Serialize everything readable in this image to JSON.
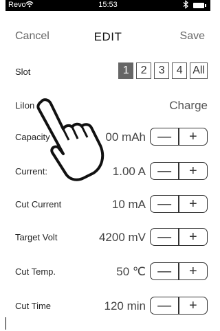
{
  "status_bar": {
    "carrier": "Revo",
    "time": "15:53"
  },
  "nav": {
    "cancel_label": "Cancel",
    "title": "EDIT",
    "save_label": "Save"
  },
  "slot": {
    "label": "Slot",
    "options": [
      "1",
      "2",
      "3",
      "4",
      "All"
    ],
    "selected": "1"
  },
  "battery_type": {
    "label": "LiIon",
    "mode": "Charge"
  },
  "settings": [
    {
      "label": "Capacity",
      "value": "00 mAh"
    },
    {
      "label": "Current:",
      "value": "1.00 A"
    },
    {
      "label": "Cut Current",
      "value": "10 mA"
    },
    {
      "label": "Target Volt",
      "value": "4200 mV"
    },
    {
      "label": "Cut Temp.",
      "value": "50 ℃"
    },
    {
      "label": "Cut Time",
      "value": "120 min"
    }
  ],
  "stepper": {
    "minus": "—",
    "plus": "+"
  },
  "icons": {
    "wifi": "wifi-icon",
    "bluetooth": "bluetooth-icon",
    "battery": "battery-icon",
    "hand": "pointing-hand-icon"
  }
}
